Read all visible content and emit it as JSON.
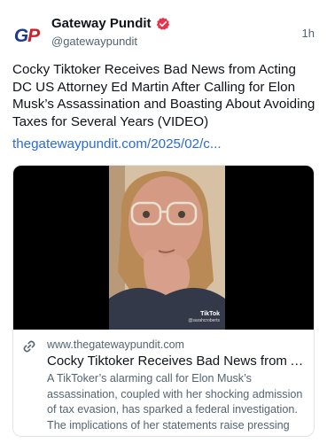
{
  "account": {
    "display_name": "Gateway Pundit",
    "handle": "@gatewaypundit",
    "time": "1h",
    "avatar_text": "GP",
    "avatar_colors": {
      "g": "#1f3a8c",
      "p": "#c8232b"
    },
    "verified_color": "#e8334a"
  },
  "post": {
    "text": "Cocky Tiktoker Receives Bad News from Acting DC US Attorney Ed Martin After Calling for Elon Musk’s Assassination and Boasting About Avoiding Taxes for Several Years (VIDEO)",
    "link": "thegatewaypundit.com/2025/02/c...",
    "link_color": "#2a6bd4"
  },
  "card": {
    "media_overlay": {
      "logo": "TikTok",
      "user": "@sarahcroberts"
    },
    "domain": "www.thegatewaypundit.com",
    "title": "Cocky Tiktoker Receives Bad News from Acting DC US Attorney Ed Martin After Calling for Elon Musk’s Assassination",
    "description": "A TikToker’s alarming call for Elon Musk’s assassination, coupled with her shocking admission of tax evasion, has sparked a federal investigation. The implications of her statements raise pressing legal and ethical questi..."
  }
}
